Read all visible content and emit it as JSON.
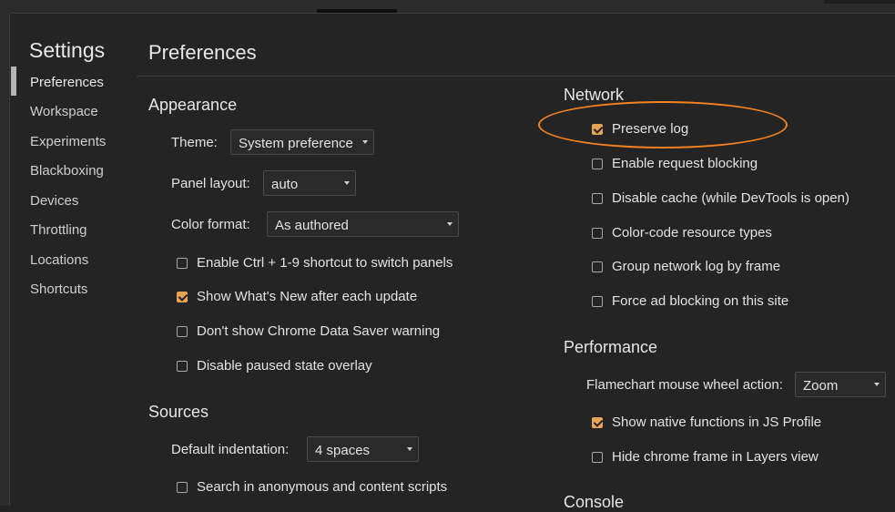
{
  "sidebar": {
    "title": "Settings",
    "items": [
      {
        "label": "Preferences",
        "active": true
      },
      {
        "label": "Workspace"
      },
      {
        "label": "Experiments"
      },
      {
        "label": "Blackboxing"
      },
      {
        "label": "Devices"
      },
      {
        "label": "Throttling"
      },
      {
        "label": "Locations"
      },
      {
        "label": "Shortcuts"
      }
    ]
  },
  "page": {
    "title": "Preferences"
  },
  "appearance": {
    "title": "Appearance",
    "theme": {
      "label": "Theme:",
      "value": "System preference"
    },
    "panel_layout": {
      "label": "Panel layout:",
      "value": "auto"
    },
    "color_format": {
      "label": "Color format:",
      "value": "As authored"
    },
    "checkboxes": [
      {
        "label": "Enable Ctrl + 1-9 shortcut to switch panels",
        "checked": false
      },
      {
        "label": "Show What's New after each update",
        "checked": true
      },
      {
        "label": "Don't show Chrome Data Saver warning",
        "checked": false
      },
      {
        "label": "Disable paused state overlay",
        "checked": false
      }
    ]
  },
  "sources": {
    "title": "Sources",
    "default_indentation": {
      "label": "Default indentation:",
      "value": "4 spaces"
    },
    "checkboxes": [
      {
        "label": "Search in anonymous and content scripts",
        "checked": false
      }
    ]
  },
  "network": {
    "title": "Network",
    "checkboxes": [
      {
        "label": "Preserve log",
        "checked": true
      },
      {
        "label": "Enable request blocking",
        "checked": false
      },
      {
        "label": "Disable cache (while DevTools is open)",
        "checked": false
      },
      {
        "label": "Color-code resource types",
        "checked": false
      },
      {
        "label": "Group network log by frame",
        "checked": false
      },
      {
        "label": "Force ad blocking on this site",
        "checked": false
      }
    ]
  },
  "performance": {
    "title": "Performance",
    "flamechart": {
      "label": "Flamechart mouse wheel action:",
      "value": "Zoom"
    },
    "checkboxes": [
      {
        "label": "Show native functions in JS Profile",
        "checked": true
      },
      {
        "label": "Hide chrome frame in Layers view",
        "checked": false
      }
    ]
  },
  "console": {
    "title": "Console"
  },
  "colors": {
    "accent": "#e8a455",
    "highlight": "#f58220",
    "background": "#242424"
  }
}
